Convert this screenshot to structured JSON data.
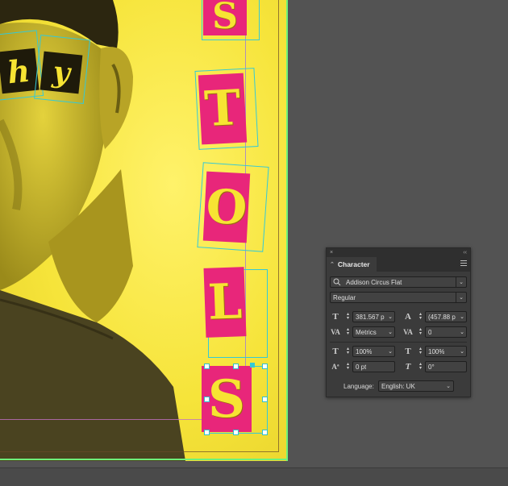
{
  "document": {
    "ransom_letters_vertical": [
      "S",
      "T",
      "O",
      "L",
      "S"
    ],
    "ransom_letters_eyes": [
      "h",
      "y"
    ]
  },
  "character_panel": {
    "close_glyph": "×",
    "collapse_glyph": "‹‹",
    "tab_label": "Character",
    "tab_arrow": "⌃",
    "font_family": "Addison Circus Flat",
    "font_style": "Regular",
    "font_size": "381.567 p",
    "leading": "(457.88 p",
    "kerning": "Metrics",
    "tracking": "0",
    "vertical_scale": "100%",
    "horizontal_scale": "100%",
    "baseline_shift": "0 pt",
    "skew": "0°",
    "language_label": "Language:",
    "language_value": "English: UK"
  },
  "colors": {
    "page_yellow": "#f6e43a",
    "letter_pink": "#e8267a",
    "selection_cyan": "#35c9d6",
    "panel_bg": "#3b3b3b",
    "workspace_bg": "#535353"
  }
}
